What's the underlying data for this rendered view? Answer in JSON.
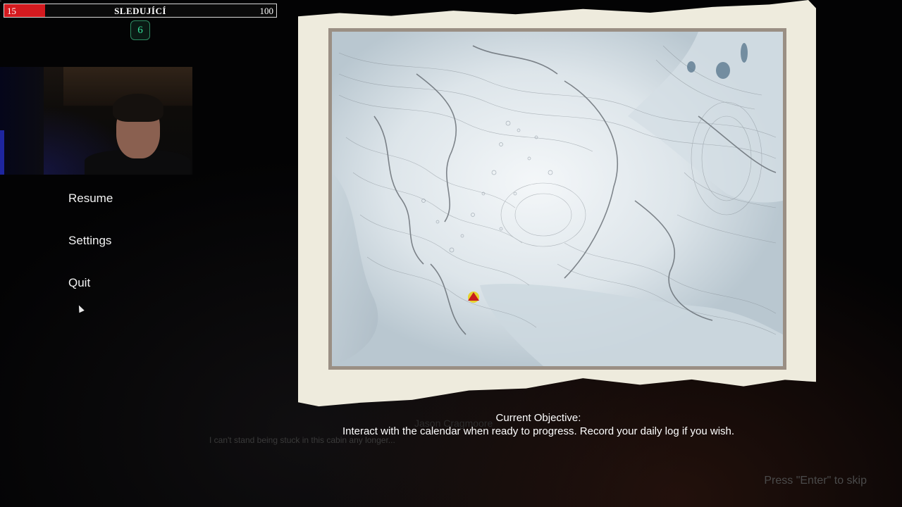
{
  "stream_overlay": {
    "follow_goal": {
      "current": "15",
      "label": "SLEDUJÍCÍ",
      "goal": "100",
      "progress": 0.15,
      "fill_color": "#d41a1f"
    },
    "counter": "6"
  },
  "pause_menu": {
    "items": [
      {
        "label": "Resume"
      },
      {
        "label": "Settings"
      },
      {
        "label": "Quit"
      }
    ]
  },
  "map": {
    "player_marker": "player-location-marker",
    "marker_color": "#e8d21a"
  },
  "subtitle": {
    "speaker": "Jason Cragmoore",
    "line": "I can't stand being stuck in this cabin any longer..."
  },
  "objective": {
    "title": "Current Objective:",
    "text": "Interact with the calendar when ready to progress. Record your daily log if you wish."
  },
  "skip_hint": "Press \"Enter\" to skip"
}
